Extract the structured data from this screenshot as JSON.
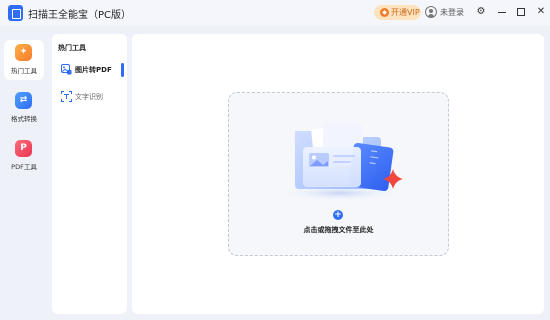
{
  "titlebar": {
    "title": "扫描王全能宝（PC版）",
    "vip_label": "开通VIP",
    "login_label": "未登录"
  },
  "rail": {
    "items": [
      {
        "label": "热门工具",
        "active": true,
        "icon": "fire-icon"
      },
      {
        "label": "格式转换",
        "active": false,
        "icon": "convert-icon"
      },
      {
        "label": "PDF工具",
        "active": false,
        "icon": "pdf-icon"
      }
    ]
  },
  "panel": {
    "heading": "热门工具",
    "items": [
      {
        "label": "图片转PDF",
        "active": true,
        "icon": "image-to-pdf-icon"
      },
      {
        "label": "文字识别",
        "active": false,
        "icon": "text-scan-icon"
      }
    ]
  },
  "dropzone": {
    "text": "点击或拖拽文件至此处"
  },
  "colors": {
    "accent": "#2f6df6",
    "vip_bg": "#ffe2be",
    "vip_text": "#c76c1f"
  }
}
